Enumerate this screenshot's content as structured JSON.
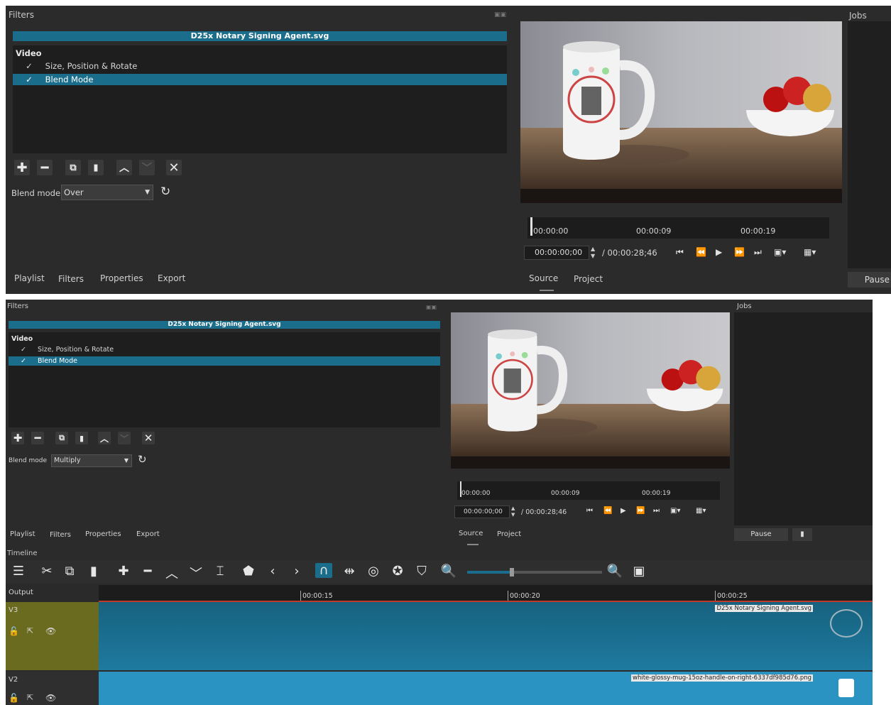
{
  "filters_panel": {
    "title": "Filters",
    "clip_name": "D25x Notary Signing Agent.svg",
    "section": "Video",
    "items": [
      {
        "check": "✓",
        "label": "Size, Position & Rotate",
        "selected": false
      },
      {
        "check": "✓",
        "label": "Blend Mode",
        "selected": true
      }
    ],
    "blend_label": "Blend mode",
    "top_blend_value": "Over",
    "bottom_blend_value": "Multiply"
  },
  "bottom_tabs": [
    "Playlist",
    "Filters",
    "Properties",
    "Export"
  ],
  "player": {
    "ruler_ticks": [
      "00:00:00",
      "00:00:09",
      "00:00:19"
    ],
    "current_tc": "00:00:00;00",
    "total_tc": "/ 00:00:28;46",
    "tabs": [
      "Source",
      "Project"
    ]
  },
  "jobs_panel": {
    "title": "Jobs",
    "pause_label": "Pause"
  },
  "timeline": {
    "title": "Timeline",
    "output_label": "Output",
    "ruler_ticks": [
      "00:00:15",
      "00:00:20",
      "00:00:25"
    ],
    "tracks": [
      {
        "name": "V3",
        "clip_label": "D25x Notary Signing Agent.svg"
      },
      {
        "name": "V2",
        "clip_label": "white-glossy-mug-15oz-handle-on-right-6337df985d76.png"
      }
    ]
  },
  "icons": {
    "add": "plus-icon",
    "remove": "minus-icon",
    "copy": "copy-icon",
    "paste": "paste-icon",
    "up": "chevron-up-icon",
    "down": "chevron-down-icon",
    "close": "close-icon",
    "reset": "reset-icon",
    "lock": "lock-icon",
    "eye": "eye-icon"
  },
  "colors": {
    "selection": "#1b6d8c",
    "panel_bg": "#2b2b2b",
    "track_head_v3": "#6b6b1f",
    "clip_blue": "#1e6d8f",
    "playhead": "#c0392b"
  }
}
